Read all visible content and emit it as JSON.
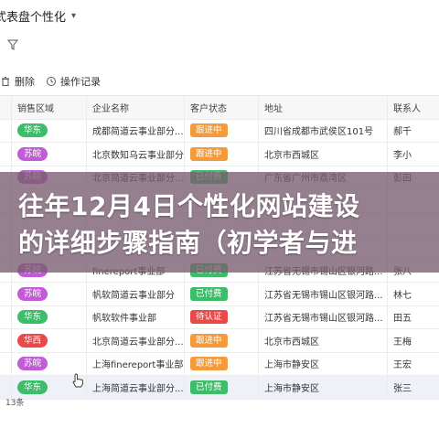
{
  "app": {
    "title": "式表盘个性化",
    "title_caret": "▾"
  },
  "toolbar": {
    "delete_label": "删除",
    "history_label": "操作记录"
  },
  "columns": [
    "销售区域",
    "企业名称",
    "客户状态",
    "地址",
    "联系人"
  ],
  "rows": [
    {
      "num": "",
      "region": "华东",
      "company": "成都简道云事业部分...",
      "status": "跟进中",
      "address": "四川省成都市武侯区101号",
      "contact": "郝千"
    },
    {
      "num": "",
      "region": "苏皖",
      "company": "北京数知乌云事业部分...",
      "status": "跟进中",
      "address": "北京市西城区",
      "contact": "李小"
    },
    {
      "num": "",
      "region": "苏皖",
      "company": "北京简道云事业部分...",
      "status": "已付费",
      "address": "广东省广州市荔湾区",
      "contact": "彭田"
    },
    {
      "num": "",
      "region": "",
      "company": "",
      "status": "",
      "address": "",
      "contact": ""
    },
    {
      "num": "",
      "region": "",
      "company": "",
      "status": "",
      "address": "",
      "contact": ""
    },
    {
      "num": "",
      "region": "",
      "company": "",
      "status": "",
      "address": "",
      "contact": ""
    },
    {
      "num": "",
      "region": "苏皖",
      "company": "finereport事业部",
      "status": "已付费",
      "address": "江苏省无锡市锡山区银河路...",
      "contact": "张八"
    },
    {
      "num": "",
      "region": "苏皖",
      "company": "帆软简道云事业部分",
      "status": "已付费",
      "address": "江苏省无锡市锡山区银河路...",
      "contact": "林七"
    },
    {
      "num": "",
      "region": "华东",
      "company": "帆软软件事业部",
      "status": "待认证",
      "address": "江苏省无锡市锡山区银河路...",
      "contact": "田五"
    },
    {
      "num": "",
      "region": "华西",
      "company": "北京简道云事业部分...",
      "status": "跟进中",
      "address": "北京市西城区",
      "contact": "王梅"
    },
    {
      "num": "",
      "region": "苏皖",
      "company": "上海finereport事业部...",
      "status": "跟进中",
      "address": "上海市静安区",
      "contact": "王宏"
    },
    {
      "num": "",
      "region": "华东",
      "company": "上海简道云事业部分...",
      "status": "已付费",
      "address": "上海市静安区",
      "contact": "张三"
    }
  ],
  "footer": {
    "count_text": "13条"
  },
  "banner": {
    "line1": "往年12月4日个性化网站建设",
    "line2": "的详细步骤指南（初学者与进"
  },
  "colors": {
    "region_green": "#3dbd6a",
    "region_purple": "#c25bd6",
    "region_red": "#e84a4a",
    "status_orange": "#f49a3b",
    "status_green": "#3dbd6a",
    "status_red": "#e84a4a"
  },
  "region_color_map": {
    "华东": "region_green",
    "苏皖": "region_purple",
    "华西": "region_red"
  },
  "status_color_map": {
    "跟进中": "status_orange",
    "已付费": "status_green",
    "待认证": "status_red"
  },
  "icons": {
    "filter": "funnel-icon",
    "delete": "trash-icon",
    "history": "history-icon",
    "cursor": "hand-pointer-icon"
  }
}
